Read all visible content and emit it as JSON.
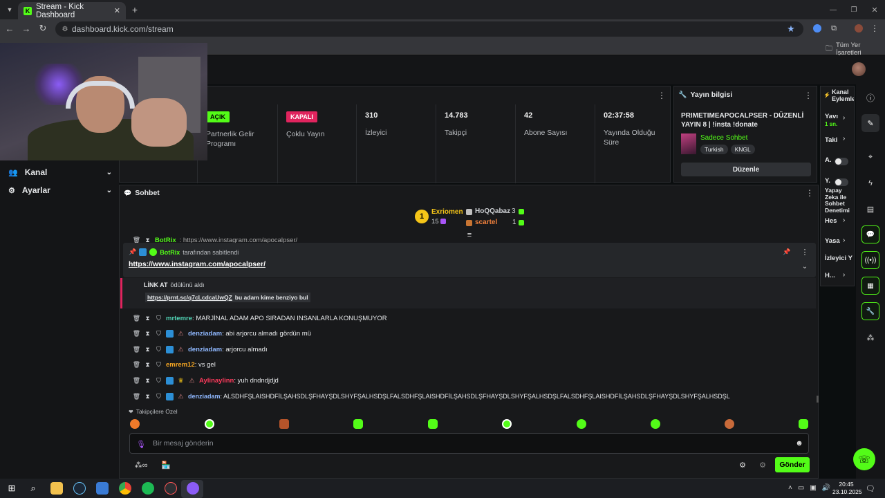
{
  "browser": {
    "tab_title": "Stream - Kick Dashboard",
    "url": "dashboard.kick.com/stream",
    "bookmarks_label": "Tüm Yer İşaretleri"
  },
  "sidebar": {
    "items": [
      {
        "label": "Kanal"
      },
      {
        "label": "Ayarlar"
      }
    ]
  },
  "stats": {
    "cells": [
      {
        "badge": "AÇIK",
        "label": "Partnerlik Gelir Programı"
      },
      {
        "badge": "KAPALI",
        "label": "Çoklu Yayın"
      },
      {
        "value": "310",
        "label": "İzleyici"
      },
      {
        "value": "14.783",
        "label": "Takipçi"
      },
      {
        "value": "42",
        "label": "Abone Sayısı"
      },
      {
        "value": "02:37:58",
        "label": "Yayında Olduğu Süre"
      }
    ]
  },
  "stream_info": {
    "header": "Yayın bilgisi",
    "title": "PRIMETIMEAPOCALPSER - DÜZENLİ YAYIN 8 | !insta !donate",
    "chat_mode": "Sadece Sohbet",
    "tags": [
      "Turkish",
      "KNGL"
    ],
    "edit_button": "Düzenle"
  },
  "channel_actions": {
    "header": "Kanal Eylemle",
    "items": [
      {
        "label": "Yavı",
        "sub": "1 sn."
      },
      {
        "label": "Taki"
      },
      {
        "label": "A."
      },
      {
        "label": "Y."
      },
      {
        "label": "Yapay Zeka ile Sohbet Denetimi"
      },
      {
        "label": "Hes"
      },
      {
        "label": "Yasa"
      },
      {
        "label": "İzleyici Y"
      },
      {
        "label": "H..."
      }
    ]
  },
  "chat": {
    "header": "Sohbet",
    "leaderboard": {
      "first": {
        "rank": "1",
        "name": "Exriomen",
        "count": "15"
      },
      "second": {
        "name": "HoQQabaz",
        "count": "3"
      },
      "third": {
        "name": "scartel",
        "count": "1"
      }
    },
    "pinned": {
      "user": "BotRix",
      "suffix": "tarafından sabitlendi",
      "link": "https://www.instagram.com/apocalpser/",
      "behind_user": "BotRix",
      "behind_text": ": https://www.instagram.com/apocalpser/"
    },
    "reward": {
      "title": "LİNK AT",
      "title_suffix": "ödülünü aldı",
      "link": "https://prnt.sc/q7cLcdcaUwQZ",
      "text": "bu adam kime benziyo bul"
    },
    "messages": [
      {
        "user": "mrtemre",
        "color": "#52d7b8",
        "text": ": MARJİNAL ADAM APO SIRADAN INSANLARLA KONUŞMUYOR"
      },
      {
        "user": "denziadam",
        "color": "#8fb8ff",
        "text": ": abi arjorcu almadı gördün mü"
      },
      {
        "user": "denziadam",
        "color": "#8fb8ff",
        "text": ": arjorcu almadı"
      },
      {
        "user": "emrem12",
        "color": "#f5a623",
        "text": ": vs gel"
      },
      {
        "user": "Aylinaylinn",
        "color": "#ff3b5c",
        "text": ": yuh dndndjdjd"
      },
      {
        "user": "denziadam",
        "color": "#8fb8ff",
        "text": ": ALSDHFŞLAISHDFİLŞAHSDLŞFHAYŞDLSHYFŞALHSDŞLFALSDHFŞLAISHDFİLŞAHSDLŞFHAYŞDLSHYFŞALHSDŞLFALSDHFŞLAISHDFİLŞAHSDLŞFHAYŞDLSHYFŞALHSDŞL"
      }
    ],
    "emote_section": "Takipçilere Özel",
    "input_placeholder": "Bir mesaj gönderin",
    "send_button": "Gönder"
  },
  "taskbar": {
    "time": "20:45",
    "date": "23.10.2025"
  },
  "colors": {
    "kick_green": "#53fc18",
    "badge_red": "#e0245e",
    "panel": "#18191b",
    "bg": "#0b0e0f"
  }
}
